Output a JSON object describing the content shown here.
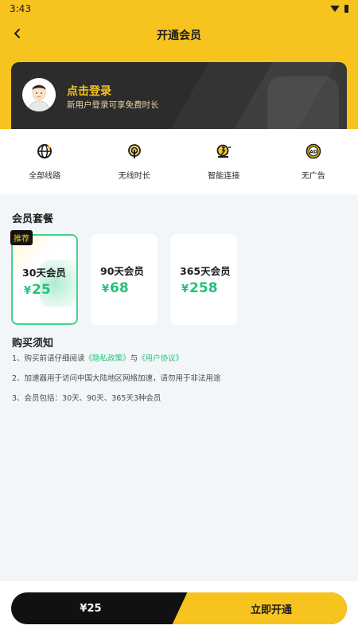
{
  "status": {
    "time": "3:43"
  },
  "header": {
    "title": "开通会员"
  },
  "login": {
    "title": "点击登录",
    "subtitle": "新用户登录可享免费时长"
  },
  "features": [
    {
      "label": "全部线路",
      "icon": "globe-icon"
    },
    {
      "label": "无线时长",
      "icon": "signal-tower-icon"
    },
    {
      "label": "智能连接",
      "icon": "smart-connect-icon"
    },
    {
      "label": "无广告",
      "icon": "no-ads-icon"
    }
  ],
  "plans_title": "会员套餐",
  "plans": [
    {
      "name": "30天会员",
      "currency": "¥",
      "price": "25",
      "badge": "推荐",
      "selected": true
    },
    {
      "name": "90天会员",
      "currency": "¥",
      "price": "68",
      "selected": false
    },
    {
      "name": "365天会员",
      "currency": "¥",
      "price": "258",
      "selected": false
    }
  ],
  "notice": {
    "title": "购买须知",
    "item1_prefix": "1、购买前请仔细阅读",
    "privacy_link": "《隐私政策》",
    "item1_mid": "与",
    "agreement_link": "《用户协议》",
    "item2": "2、加速器用于访问中国大陆地区网络加速，请勿用于非法用途",
    "item3": "3、会员包括：30天、90天、365天3种会员"
  },
  "bottom": {
    "price": "¥25",
    "button": "立即开通"
  },
  "colors": {
    "accent": "#f7c31f",
    "green": "#24c27a",
    "dark": "#111111"
  }
}
